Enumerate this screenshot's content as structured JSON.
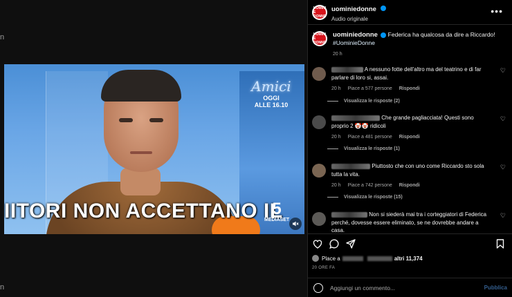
{
  "left": {
    "edge_glyph_top": "n",
    "edge_glyph_bottom": "n"
  },
  "video": {
    "caption_text": "IITORI NON ACCETTANO IL",
    "show_logo_title": "Amici",
    "show_logo_oggi": "OGGI",
    "show_logo_time": "ALLE 16.10",
    "channel_number": "5",
    "channel_name": "MEDIASET",
    "mute_icon": "speaker-muted-icon"
  },
  "header": {
    "avatar_text": "UOMINI E DONNE",
    "username": "uominiedonne",
    "audio_label": "Audio originale",
    "more_icon": "more-horizontal-icon"
  },
  "caption": {
    "username": "uominiedonne",
    "text": "Federica ha qualcosa da dire a Riccardo!",
    "hashtag": "#UominieDonne",
    "time": "20 h"
  },
  "comments": [
    {
      "name_visible": "",
      "text": "A nessuno fotte dell'altro ma del teatrino e di far parlare di loro si, assai.",
      "time": "20 h",
      "likes": "Piace a 577 persone",
      "reply": "Rispondi",
      "view_replies": "Visualizza le risposte (2)"
    },
    {
      "name_visible": "",
      "text": "Che grande pagliacciata! Questi sono proprio 2 🤡🤡 ridicoli",
      "time": "20 h",
      "likes": "Piace a 481 persone",
      "reply": "Rispondi",
      "view_replies": "Visualizza le risposte (1)"
    },
    {
      "name_visible": "",
      "text": "Piuttosto che con uno come Riccardo sto sola tutta la vita.",
      "time": "20 h",
      "likes": "Piace a 742 persone",
      "reply": "Rispondi",
      "view_replies": "Visualizza le risposte (15)"
    },
    {
      "name_visible": "",
      "text": "Non si siederà mai tra i corteggiatori di Federica perché, dovesse essere eliminato, se ne dovrebbe andare a casa."
    }
  ],
  "actions": {
    "likes_prefix": "Place a",
    "likes_suffix": "altri 11,374",
    "time_ago": "20 ORE FA"
  },
  "comment_bar": {
    "placeholder": "Aggiungi un commento...",
    "publish": "Pubblica"
  },
  "colors": {
    "accent_blue": "#0095f6",
    "brand_red": "#d6141c",
    "background": "#000000"
  }
}
